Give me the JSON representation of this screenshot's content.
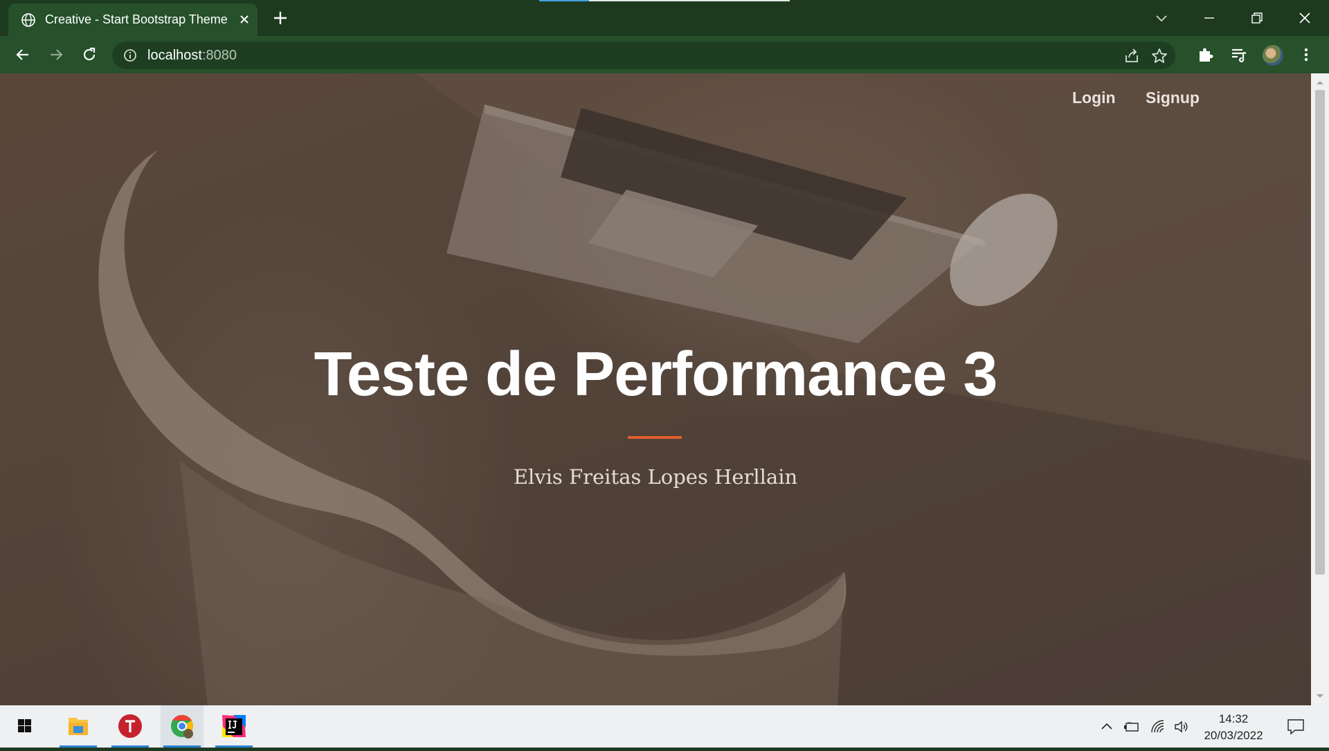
{
  "browser": {
    "tab_title": "Creative - Start Bootstrap Theme",
    "url_host": "localhost",
    "url_port": ":8080"
  },
  "page": {
    "nav": {
      "login": "Login",
      "signup": "Signup"
    },
    "headline": "Teste de Performance 3",
    "subtitle": "Elvis Freitas Lopes Herllain",
    "accent_color": "#e05d2c"
  },
  "taskbar": {
    "apps": [
      "windows-start",
      "file-explorer",
      "todoist",
      "google-chrome",
      "intellij-idea"
    ],
    "time": "14:32",
    "date": "20/03/2022"
  }
}
